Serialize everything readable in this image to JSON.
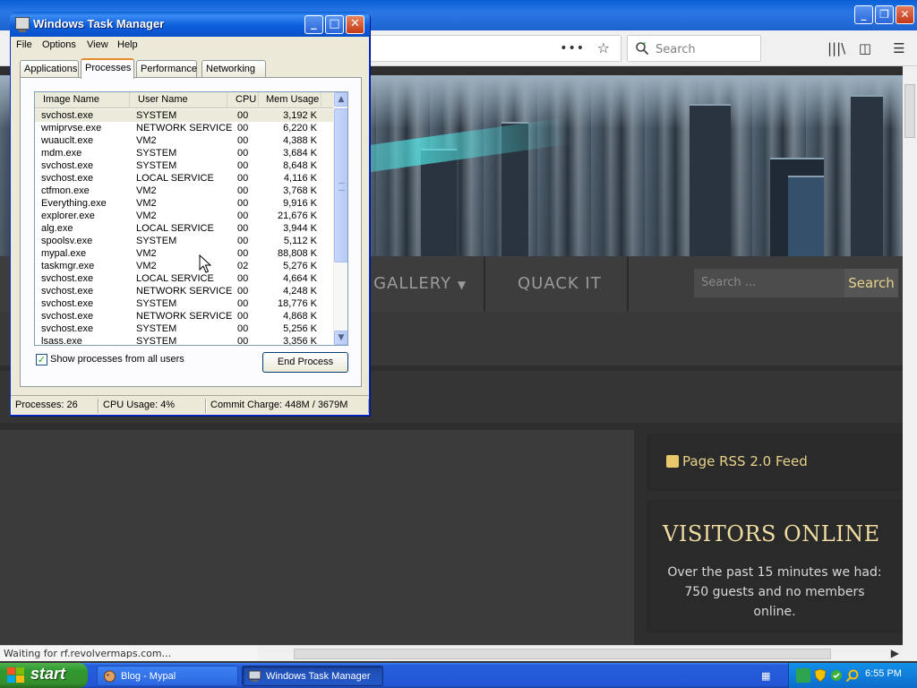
{
  "browser": {
    "search_placeholder": "Search",
    "status_text": "Waiting for rf.revolvermaps.com...",
    "window_buttons": [
      "minimize",
      "restore",
      "close"
    ],
    "toolbar_icons": [
      "more-icon",
      "bookmark-star-icon",
      "library-icon",
      "sidebar-icon",
      "menu-icon"
    ]
  },
  "site": {
    "nav": {
      "gallery": "E GALLERY",
      "quack": "QUACK IT",
      "search_placeholder": "Search ...",
      "search_button": "Search"
    },
    "rss_link": "Page RSS 2.0 Feed",
    "visitors": {
      "title": "VISITORS ONLINE",
      "text": "Over the past 15 minutes we had: 750 guests and no members online."
    },
    "colors": {
      "accent": "#e8d28a",
      "background": "#2e2e2e"
    }
  },
  "task_manager": {
    "title": "Windows Task Manager",
    "menu": [
      "File",
      "Options",
      "View",
      "Help"
    ],
    "tabs": [
      "Applications",
      "Processes",
      "Performance",
      "Networking"
    ],
    "active_tab": "Processes",
    "columns": [
      "Image Name",
      "User Name",
      "CPU",
      "Mem Usage"
    ],
    "processes": [
      {
        "image": "svchost.exe",
        "user": "SYSTEM",
        "cpu": "00",
        "mem": "3,192 K"
      },
      {
        "image": "wmiprvse.exe",
        "user": "NETWORK SERVICE",
        "cpu": "00",
        "mem": "6,220 K"
      },
      {
        "image": "wuauclt.exe",
        "user": "VM2",
        "cpu": "00",
        "mem": "4,388 K"
      },
      {
        "image": "mdm.exe",
        "user": "SYSTEM",
        "cpu": "00",
        "mem": "3,684 K"
      },
      {
        "image": "svchost.exe",
        "user": "SYSTEM",
        "cpu": "00",
        "mem": "8,648 K"
      },
      {
        "image": "svchost.exe",
        "user": "LOCAL SERVICE",
        "cpu": "00",
        "mem": "4,116 K"
      },
      {
        "image": "ctfmon.exe",
        "user": "VM2",
        "cpu": "00",
        "mem": "3,768 K"
      },
      {
        "image": "Everything.exe",
        "user": "VM2",
        "cpu": "00",
        "mem": "9,916 K"
      },
      {
        "image": "explorer.exe",
        "user": "VM2",
        "cpu": "00",
        "mem": "21,676 K"
      },
      {
        "image": "alg.exe",
        "user": "LOCAL SERVICE",
        "cpu": "00",
        "mem": "3,944 K"
      },
      {
        "image": "spoolsv.exe",
        "user": "SYSTEM",
        "cpu": "00",
        "mem": "5,112 K"
      },
      {
        "image": "mypal.exe",
        "user": "VM2",
        "cpu": "00",
        "mem": "88,808 K"
      },
      {
        "image": "taskmgr.exe",
        "user": "VM2",
        "cpu": "02",
        "mem": "5,276 K"
      },
      {
        "image": "svchost.exe",
        "user": "LOCAL SERVICE",
        "cpu": "00",
        "mem": "4,664 K"
      },
      {
        "image": "svchost.exe",
        "user": "NETWORK SERVICE",
        "cpu": "00",
        "mem": "4,248 K"
      },
      {
        "image": "svchost.exe",
        "user": "SYSTEM",
        "cpu": "00",
        "mem": "18,776 K"
      },
      {
        "image": "svchost.exe",
        "user": "NETWORK SERVICE",
        "cpu": "00",
        "mem": "4,868 K"
      },
      {
        "image": "svchost.exe",
        "user": "SYSTEM",
        "cpu": "00",
        "mem": "5,256 K"
      },
      {
        "image": "lsass.exe",
        "user": "SYSTEM",
        "cpu": "00",
        "mem": "3,356 K"
      }
    ],
    "show_all_users_label": "Show processes from all users",
    "show_all_users_checked": true,
    "end_process_label": "End Process",
    "status": {
      "processes": "Processes: 26",
      "cpu": "CPU Usage: 4%",
      "commit": "Commit Charge: 448M / 3679M"
    }
  },
  "taskbar": {
    "start_label": "start",
    "tasks": [
      {
        "label": "Blog - Mypal",
        "active": false
      },
      {
        "label": "Windows Task Manager",
        "active": true
      }
    ],
    "clock": "6:55 PM",
    "tray_icons": [
      "network-icon",
      "security-shield-icon",
      "update-icon",
      "search-tray-icon"
    ]
  }
}
